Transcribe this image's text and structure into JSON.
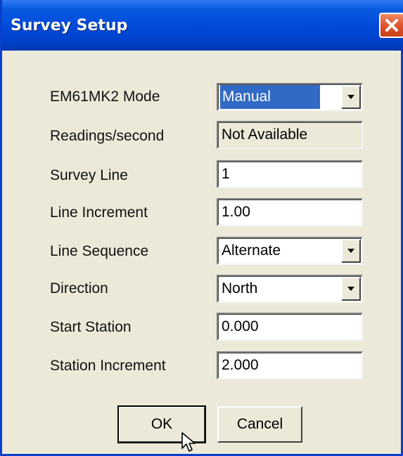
{
  "window": {
    "title": "Survey Setup",
    "icons": {
      "close": "close-icon",
      "dropdown": "dropdown-arrow-icon",
      "cursor": "mouse-pointer-icon"
    },
    "colors": {
      "titlebar": "#0049d8",
      "body": "#ece9d8",
      "selection": "#316ac5",
      "close": "#e0552e"
    }
  },
  "fields": {
    "mode": {
      "label": "EM61MK2 Mode",
      "value": "Manual"
    },
    "readings": {
      "label": "Readings/second",
      "value": "Not Available"
    },
    "survey_line": {
      "label": "Survey Line",
      "value": "1"
    },
    "line_increment": {
      "label": "Line Increment",
      "value": "1.00"
    },
    "line_sequence": {
      "label": "Line Sequence",
      "value": "Alternate"
    },
    "direction": {
      "label": "Direction",
      "value": "North"
    },
    "start_station": {
      "label": "Start Station",
      "value": "0.000"
    },
    "station_increment": {
      "label": "Station Increment",
      "value": "2.000"
    }
  },
  "buttons": {
    "ok": "OK",
    "cancel": "Cancel"
  }
}
